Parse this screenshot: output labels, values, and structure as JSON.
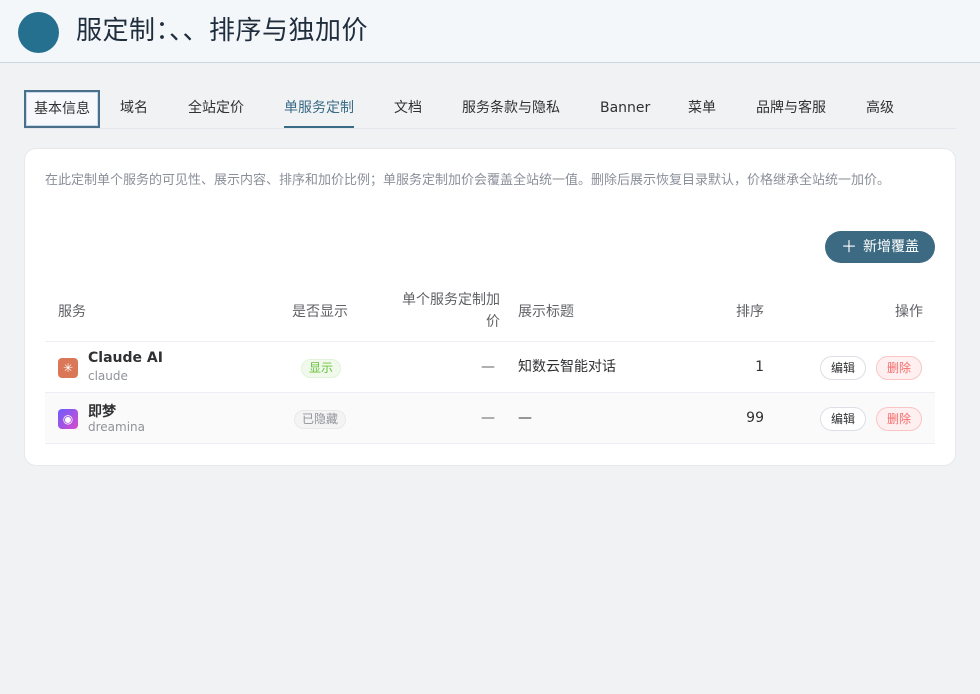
{
  "header": {
    "logo_glyph": "",
    "title": "服定制：、、排序与独加价"
  },
  "tabs": [
    {
      "label": "基本信息"
    },
    {
      "label": "域名"
    },
    {
      "label": "全站定价"
    },
    {
      "label": "单服务定制"
    },
    {
      "label": "文档"
    },
    {
      "label": "服务条款与隐私"
    },
    {
      "label": "Banner"
    },
    {
      "label": "菜单"
    },
    {
      "label": "品牌与客服"
    },
    {
      "label": "高级"
    }
  ],
  "active_tab": "单服务定制",
  "card": {
    "description": "在此定制单个服务的可见性、展示内容、排序和加价比例；单服务定制加价会覆盖全站统一值。删除后展示恢复目录默认，价格继承全站统一加价。",
    "add_button": "新增覆盖",
    "add_icon": "plus-icon"
  },
  "table": {
    "headers": {
      "service": "服务",
      "visible": "是否显示",
      "price": "单个服务定制加价",
      "display_title": "展示标题",
      "sort": "排序",
      "ops": "操作"
    },
    "rows": [
      {
        "name": "Claude AI",
        "slug": "claude",
        "icon": "claude-icon",
        "visible": "显示",
        "price": "—",
        "display_title": "知数云智能对话",
        "sort": "1",
        "edit": "编辑",
        "delete": "删除"
      },
      {
        "name": "即梦",
        "slug": "dreamina",
        "icon": "dreamina-icon",
        "visible": "已隐藏",
        "price": "—",
        "display_title": "—",
        "sort": "99",
        "edit": "编辑",
        "delete": "删除"
      }
    ]
  },
  "colors": {
    "accent": "#3b6a82",
    "logo": "#26708f",
    "visible_badge": "#67c23a",
    "delete": "#f56c6c"
  }
}
